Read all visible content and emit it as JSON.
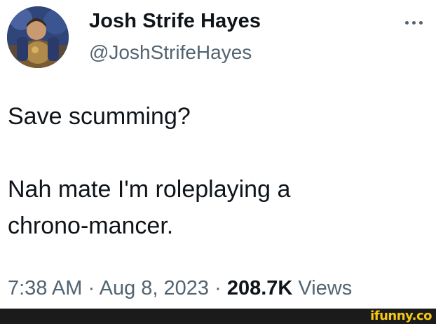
{
  "tweet": {
    "author": {
      "display_name": "Josh Strife Hayes",
      "handle": "@JoshStrifeHayes"
    },
    "more_icon": "more-dots-icon",
    "text_line_1": "Save scumming?",
    "text_line_2": "Nah mate I'm roleplaying a\nchrono-mancer.",
    "time": "7:38 AM",
    "separator": "·",
    "date": "Aug 8, 2023",
    "views_count": "208.7K",
    "views_label": "Views"
  },
  "watermark": {
    "text": "ifunny.co",
    "color": "#f5c814"
  },
  "colors": {
    "text_primary": "#0f1419",
    "text_secondary": "#536471",
    "footer_bar": "#1b1b1b"
  }
}
